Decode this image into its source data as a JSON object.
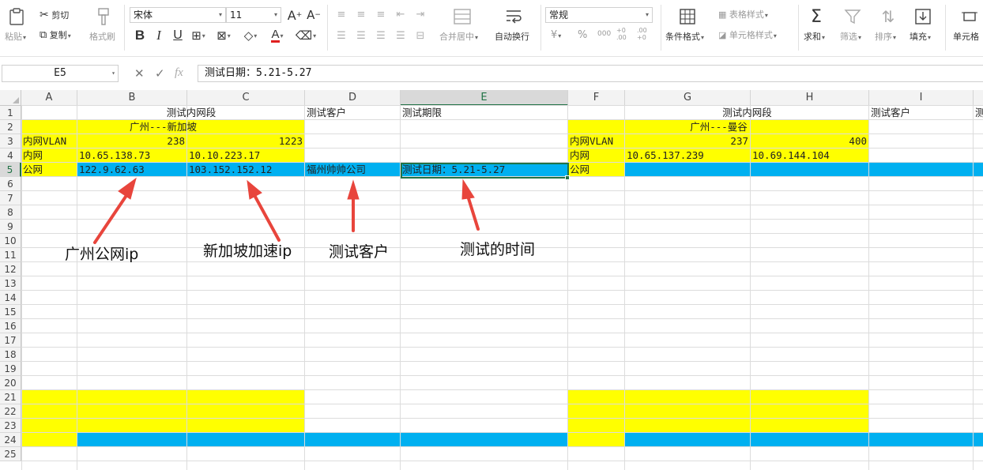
{
  "ribbon": {
    "paste": "粘贴",
    "cut": "剪切",
    "copy": "复制",
    "format_painter": "格式刷",
    "font_name": "宋体",
    "font_size": "11",
    "bold": "B",
    "italic": "I",
    "underline": "U",
    "merge_center": "合并居中",
    "wrap_text": "自动换行",
    "number_format": "常规",
    "currency": "¥",
    "percent": "%",
    "thousands": "000",
    "inc_decimal": "+0 .00",
    "dec_decimal": ".00 +0",
    "conditional_format": "条件格式",
    "table_style": "表格样式",
    "cell_style": "单元格样式",
    "sum": "求和",
    "filter": "筛选",
    "sort": "排序",
    "fill": "填充",
    "cell": "单元格"
  },
  "formula_bar": {
    "name_box": "E5",
    "content": "测试日期：5.21-5.27"
  },
  "columns": [
    "A",
    "B",
    "C",
    "D",
    "E",
    "F",
    "G",
    "H",
    "I"
  ],
  "rows": [
    "1",
    "2",
    "3",
    "4",
    "5",
    "6",
    "7",
    "8",
    "9",
    "10",
    "11",
    "12",
    "13",
    "14",
    "15",
    "16",
    "17",
    "18",
    "19",
    "20",
    "21",
    "22",
    "23",
    "24",
    "25"
  ],
  "cells": {
    "B1": "测试内网段",
    "D1": "测试客户",
    "E1": "测试期限",
    "B2": "广州---新加坡",
    "A3": "内网VLAN",
    "B3": "238",
    "C3": "1223",
    "A4": "内网",
    "B4": "10.65.138.73",
    "C4": "10.10.223.17",
    "A5": "公网",
    "B5": "122.9.62.63",
    "C5": "103.152.152.12",
    "D5": "福州帅帅公司",
    "E5": "测试日期：5.21-5.27",
    "G1": "测试内网段",
    "I1": "测试客户",
    "J1": "测",
    "G2": "广州---曼谷",
    "F3": "内网VLAN",
    "G3": "237",
    "H3": "400",
    "F4": "内网",
    "G4": "10.65.137.239",
    "H4": "10.69.144.104",
    "F5": "公网",
    "…": "…"
  },
  "annotations": {
    "guangzhou_ip": "广州公网ip",
    "singapore_ip": "新加坡加速ip",
    "customer": "测试客户",
    "time": "测试的时间"
  },
  "colors": {
    "yellow": "#FFFF00",
    "cyan": "#00B0F0",
    "selection": "#217346",
    "arrow": "#E8453C"
  }
}
